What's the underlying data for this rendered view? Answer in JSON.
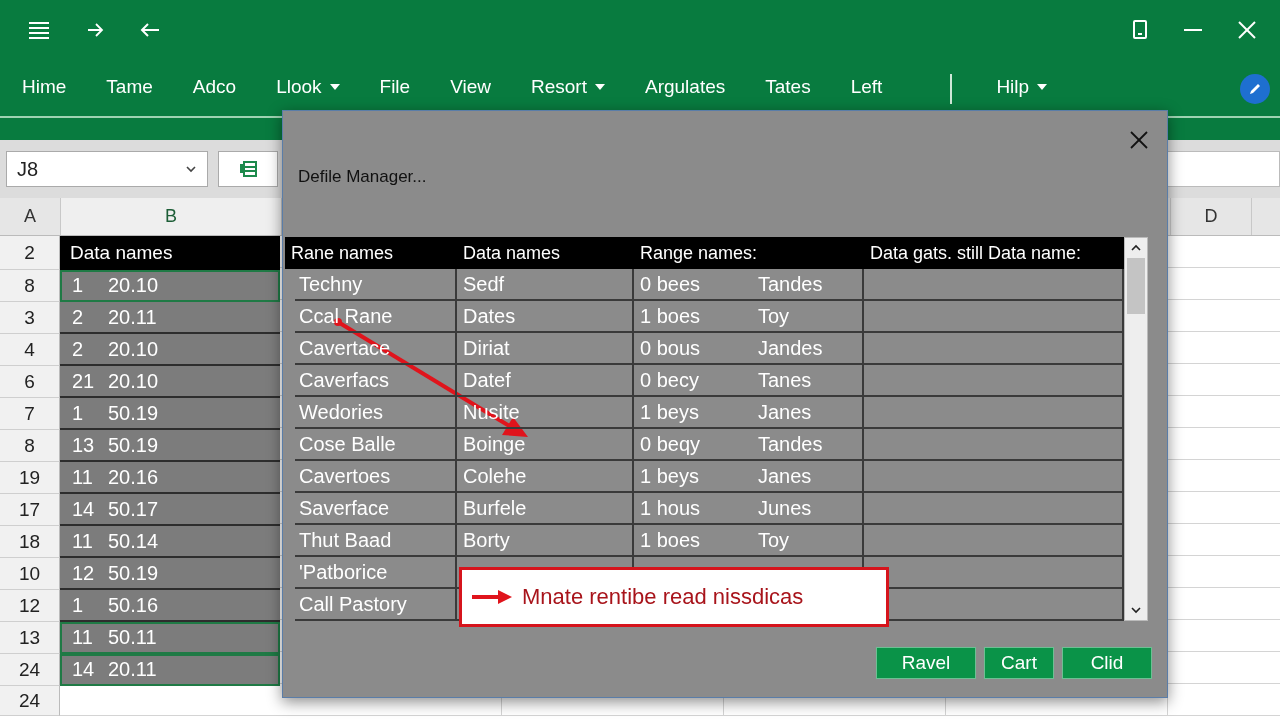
{
  "ribbon": {
    "tabs": [
      {
        "kind": "tab",
        "label": "Hime",
        "dropdown": false
      },
      {
        "kind": "tab",
        "label": "Tame",
        "dropdown": false
      },
      {
        "kind": "tab",
        "label": "Adco",
        "dropdown": false
      },
      {
        "kind": "tab",
        "label": "Llook",
        "dropdown": true
      },
      {
        "kind": "tab",
        "label": "File",
        "dropdown": false
      },
      {
        "kind": "tab",
        "label": "View",
        "dropdown": false
      },
      {
        "kind": "tab",
        "label": "Resort",
        "dropdown": true
      },
      {
        "kind": "tab",
        "label": "Argulates",
        "dropdown": false
      },
      {
        "kind": "tab",
        "label": "Tates",
        "dropdown": false
      },
      {
        "kind": "tab",
        "label": "Left",
        "dropdown": false
      },
      {
        "kind": "separator"
      },
      {
        "kind": "tab",
        "label": "Hilp",
        "dropdown": true
      }
    ]
  },
  "name_box": {
    "value": "J8"
  },
  "sheet": {
    "column_headers": [
      "A",
      "B",
      "D"
    ],
    "header_row": {
      "row_number": "2",
      "label": "Data names"
    },
    "rows": [
      {
        "row_number": "8",
        "count": "1",
        "value": "20.10",
        "selected": true
      },
      {
        "row_number": "3",
        "count": "2",
        "value": "20.11",
        "selected": false
      },
      {
        "row_number": "4",
        "count": "2",
        "value": "20.10",
        "selected": false
      },
      {
        "row_number": "6",
        "count": "21",
        "value": "20.10",
        "selected": false
      },
      {
        "row_number": "7",
        "count": "1",
        "value": "50.19",
        "selected": false
      },
      {
        "row_number": "8",
        "count": "13",
        "value": "50.19",
        "selected": false
      },
      {
        "row_number": "19",
        "count": "11",
        "value": "20.16",
        "selected": false
      },
      {
        "row_number": "17",
        "count": "14",
        "value": "50.17",
        "selected": false
      },
      {
        "row_number": "18",
        "count": "11",
        "value": "50.14",
        "selected": false
      },
      {
        "row_number": "10",
        "count": "12",
        "value": "50.19",
        "selected": false
      },
      {
        "row_number": "12",
        "count": "1",
        "value": "50.16",
        "selected": false
      },
      {
        "row_number": "13",
        "count": "11",
        "value": "50.11",
        "selected": true
      },
      {
        "row_number": "24",
        "count": "14",
        "value": "20.11",
        "selected": true
      }
    ],
    "trailing_row": "24"
  },
  "dialog": {
    "title": "Defile Manager...",
    "columns": [
      "Rane names",
      "Data names",
      "Range names:",
      "Data gats. still Data name:"
    ],
    "rows": [
      {
        "range_name": "Techny",
        "data_name": "Sedf",
        "count": "0 bees",
        "range": "Tandes"
      },
      {
        "range_name": "Ccal Rane",
        "data_name": "Dates",
        "count": "1 boes",
        "range": "Toy"
      },
      {
        "range_name": "Cavertace",
        "data_name": "Diriat",
        "count": "0 bous",
        "range": "Jandes"
      },
      {
        "range_name": "Caverfacs",
        "data_name": "Datef",
        "count": "0 becy",
        "range": "Tanes"
      },
      {
        "range_name": "Wedories",
        "data_name": "Nusite",
        "count": "1 beys",
        "range": "Janes"
      },
      {
        "range_name": "Cose Balle",
        "data_name": "Boinge",
        "count": "0 beqy",
        "range": "Tandes"
      },
      {
        "range_name": "Cavertoes",
        "data_name": "Colehe",
        "count": "1 beys",
        "range": "Janes"
      },
      {
        "range_name": "Saverface",
        "data_name": "Burfele",
        "count": "1 hous",
        "range": "Junes"
      },
      {
        "range_name": "Thut Baad",
        "data_name": "Borty",
        "count": "1 boes",
        "range": "Toy"
      },
      {
        "range_name": "'Patborice"
      },
      {
        "range_name": "Call Pastory"
      }
    ],
    "callout": {
      "text": "Mnate rentibe read nissdicas"
    },
    "buttons": [
      "Ravel",
      "Cart",
      "Clid"
    ]
  }
}
